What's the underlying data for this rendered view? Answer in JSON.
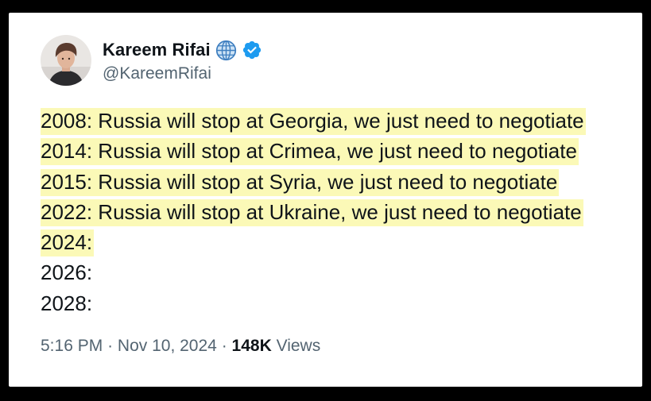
{
  "author": {
    "display_name": "Kareem Rifai",
    "handle": "@KareemRifai",
    "avatar": "profile-photo",
    "affiliation_icon": "globe-icon",
    "verified_icon": "verified-badge-icon",
    "verified_color": "#1d9bf0"
  },
  "post": {
    "lines": [
      {
        "text": "2008: Russia will stop at Georgia, we just need to negotiate",
        "highlighted": true
      },
      {
        "text": "2014: Russia will stop at Crimea, we just need to negotiate",
        "highlighted": true
      },
      {
        "text": "2015: Russia will stop at Syria, we just need to negotiate",
        "highlighted": true
      },
      {
        "text": "2022: Russia will stop at Ukraine, we just need to negotiate",
        "highlighted": true
      },
      {
        "text": "2024:",
        "highlighted": true
      },
      {
        "text": "2026:",
        "highlighted": false
      },
      {
        "text": "2028:",
        "highlighted": false
      }
    ],
    "highlight_color": "#fbf9b7"
  },
  "meta": {
    "time": "5:16 PM",
    "separator": "·",
    "date": "Nov 10, 2024",
    "views_count": "148K",
    "views_label": "Views"
  }
}
